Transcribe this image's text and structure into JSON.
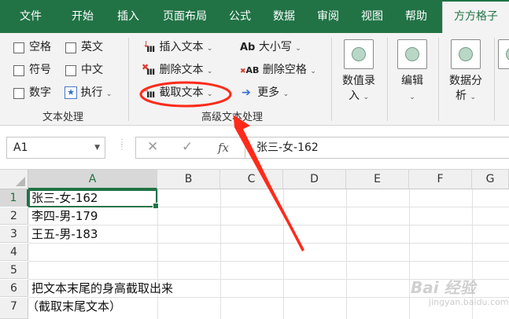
{
  "ribbon_tabs": [
    "文件",
    "开始",
    "插入",
    "页面布局",
    "公式",
    "数据",
    "审阅",
    "视图",
    "帮助",
    "方方格子"
  ],
  "text_processing": {
    "checkboxes": [
      "空格",
      "英文",
      "符号",
      "中文",
      "数字"
    ],
    "execute_label": "执行",
    "group_label": "文本处理"
  },
  "advanced_text": {
    "insert_text": "插入文本",
    "delete_text": "删除文本",
    "extract_text": "截取文本",
    "case": "大小写",
    "case_icon": "Ab",
    "delete_spaces": "删除空格",
    "delete_spaces_icon": "AB",
    "more": "更多",
    "group_label": "高级文本处理"
  },
  "big_buttons": {
    "numeric_entry": [
      "数值录",
      "入"
    ],
    "edit": "编辑",
    "data_analysis": [
      "数据分",
      "析"
    ],
    "partial": " "
  },
  "formula_bar": {
    "name_box": "A1",
    "fx": "fx",
    "content": "张三-女-162"
  },
  "columns": [
    "A",
    "B",
    "C",
    "D",
    "E",
    "F",
    "G"
  ],
  "rows": [
    "1",
    "2",
    "3",
    "4",
    "5",
    "6",
    "7"
  ],
  "cells": {
    "A1": "张三-女-162",
    "A2": "李四-男-179",
    "A3": "王五-男-183",
    "A6": "把文本末尾的身高截取出来",
    "A7": "（截取末尾文本）"
  },
  "annotation_color": "#ff2a1a",
  "accent_color": "#217346",
  "watermark": {
    "main": "Bai 经验",
    "sub": "jingyan.baidu.com"
  }
}
